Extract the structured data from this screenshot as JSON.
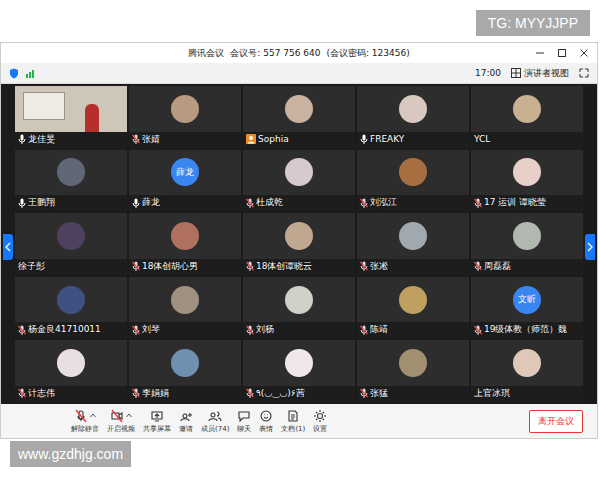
{
  "watermarks": {
    "top": "TG: MYYJJPP",
    "bottom": "www.gzdhjg.com"
  },
  "window": {
    "title": "腾讯会议",
    "meeting_id": "会议号: 557 756 640",
    "password": "(会议密码: 123456)"
  },
  "topbar": {
    "time": "17:00",
    "view": "演讲者视图"
  },
  "participants": [
    {
      "name": "龙佳旻",
      "kind": "video",
      "mic": "on",
      "tagged": false,
      "color": "#cfc6ba"
    },
    {
      "name": "张婧",
      "kind": "photo",
      "mic": "off",
      "tagged": false,
      "color": "#b89a80"
    },
    {
      "name": "Sophia",
      "kind": "photo",
      "mic": "none",
      "tagged": true,
      "color": "#c9b2a0"
    },
    {
      "name": "FREAKY",
      "kind": "photo",
      "mic": "on",
      "tagged": false,
      "color": "#d8c8c0"
    },
    {
      "name": "YCL",
      "kind": "photo",
      "mic": "none",
      "tagged": false,
      "color": "#c8b090"
    },
    {
      "name": "王鹏翔",
      "kind": "photo",
      "mic": "on",
      "tagged": false,
      "color": "#606878"
    },
    {
      "name": "薛龙",
      "kind": "text",
      "avatar_text": "薛龙",
      "mic": "on",
      "tagged": false,
      "color": "#3a86f0"
    },
    {
      "name": "杜成乾",
      "kind": "photo",
      "mic": "off",
      "tagged": false,
      "color": "#d8c8d0"
    },
    {
      "name": "刘泓江",
      "kind": "photo",
      "mic": "off",
      "tagged": false,
      "color": "#a87040"
    },
    {
      "name": "17 运训 谭晓莹",
      "kind": "photo",
      "mic": "off",
      "tagged": false,
      "color": "#e8d0c8"
    },
    {
      "name": "徐子彭",
      "kind": "photo",
      "mic": "none",
      "tagged": false,
      "color": "#504060"
    },
    {
      "name": "18体创胡心男",
      "kind": "photo",
      "mic": "off",
      "tagged": false,
      "color": "#b07060"
    },
    {
      "name": "18体创谭晓云",
      "kind": "photo",
      "mic": "off",
      "tagged": false,
      "color": "#c0a890"
    },
    {
      "name": "张凇",
      "kind": "photo",
      "mic": "off",
      "tagged": false,
      "color": "#a0a8b0"
    },
    {
      "name": "周磊磊",
      "kind": "photo",
      "mic": "off",
      "tagged": false,
      "color": "#b0b8b0"
    },
    {
      "name": "杨金良41710011",
      "kind": "photo",
      "mic": "off",
      "tagged": false,
      "color": "#405080"
    },
    {
      "name": "刘琴",
      "kind": "photo",
      "mic": "off",
      "tagged": false,
      "color": "#a09080"
    },
    {
      "name": "刘杨",
      "kind": "photo",
      "mic": "off",
      "tagged": false,
      "color": "#d0d0c8"
    },
    {
      "name": "陈靖",
      "kind": "photo",
      "mic": "off",
      "tagged": false,
      "color": "#c0a060"
    },
    {
      "name": "19级体教（师范）魏",
      "kind": "text",
      "avatar_text": "文昕",
      "mic": "off",
      "tagged": false,
      "color": "#3a86f0"
    },
    {
      "name": "计志伟",
      "kind": "photo",
      "mic": "off",
      "tagged": false,
      "color": "#e8e0e0"
    },
    {
      "name": "李娟娟",
      "kind": "photo",
      "mic": "off",
      "tagged": false,
      "color": "#7090b0"
    },
    {
      "name": "٩(◡‿◡)۶茜",
      "kind": "photo",
      "mic": "off",
      "tagged": false,
      "color": "#f0e8e8"
    },
    {
      "name": "张猛",
      "kind": "photo",
      "mic": "off",
      "tagged": false,
      "color": "#a09070"
    },
    {
      "name": "上官冰琪",
      "kind": "photo",
      "mic": "none",
      "tagged": false,
      "color": "#e0c8b8"
    }
  ],
  "toolbar": [
    {
      "label": "解除静音",
      "caret": true
    },
    {
      "label": "开启视频",
      "caret": true
    },
    {
      "label": "共享屏幕",
      "caret": false
    },
    {
      "label": "邀请",
      "caret": false
    },
    {
      "label": "成员(74)",
      "caret": false
    },
    {
      "label": "聊天",
      "caret": false
    },
    {
      "label": "表情",
      "caret": false
    },
    {
      "label": "文档(1)",
      "caret": false
    },
    {
      "label": "设置",
      "caret": false
    }
  ],
  "leave": "离开会议"
}
